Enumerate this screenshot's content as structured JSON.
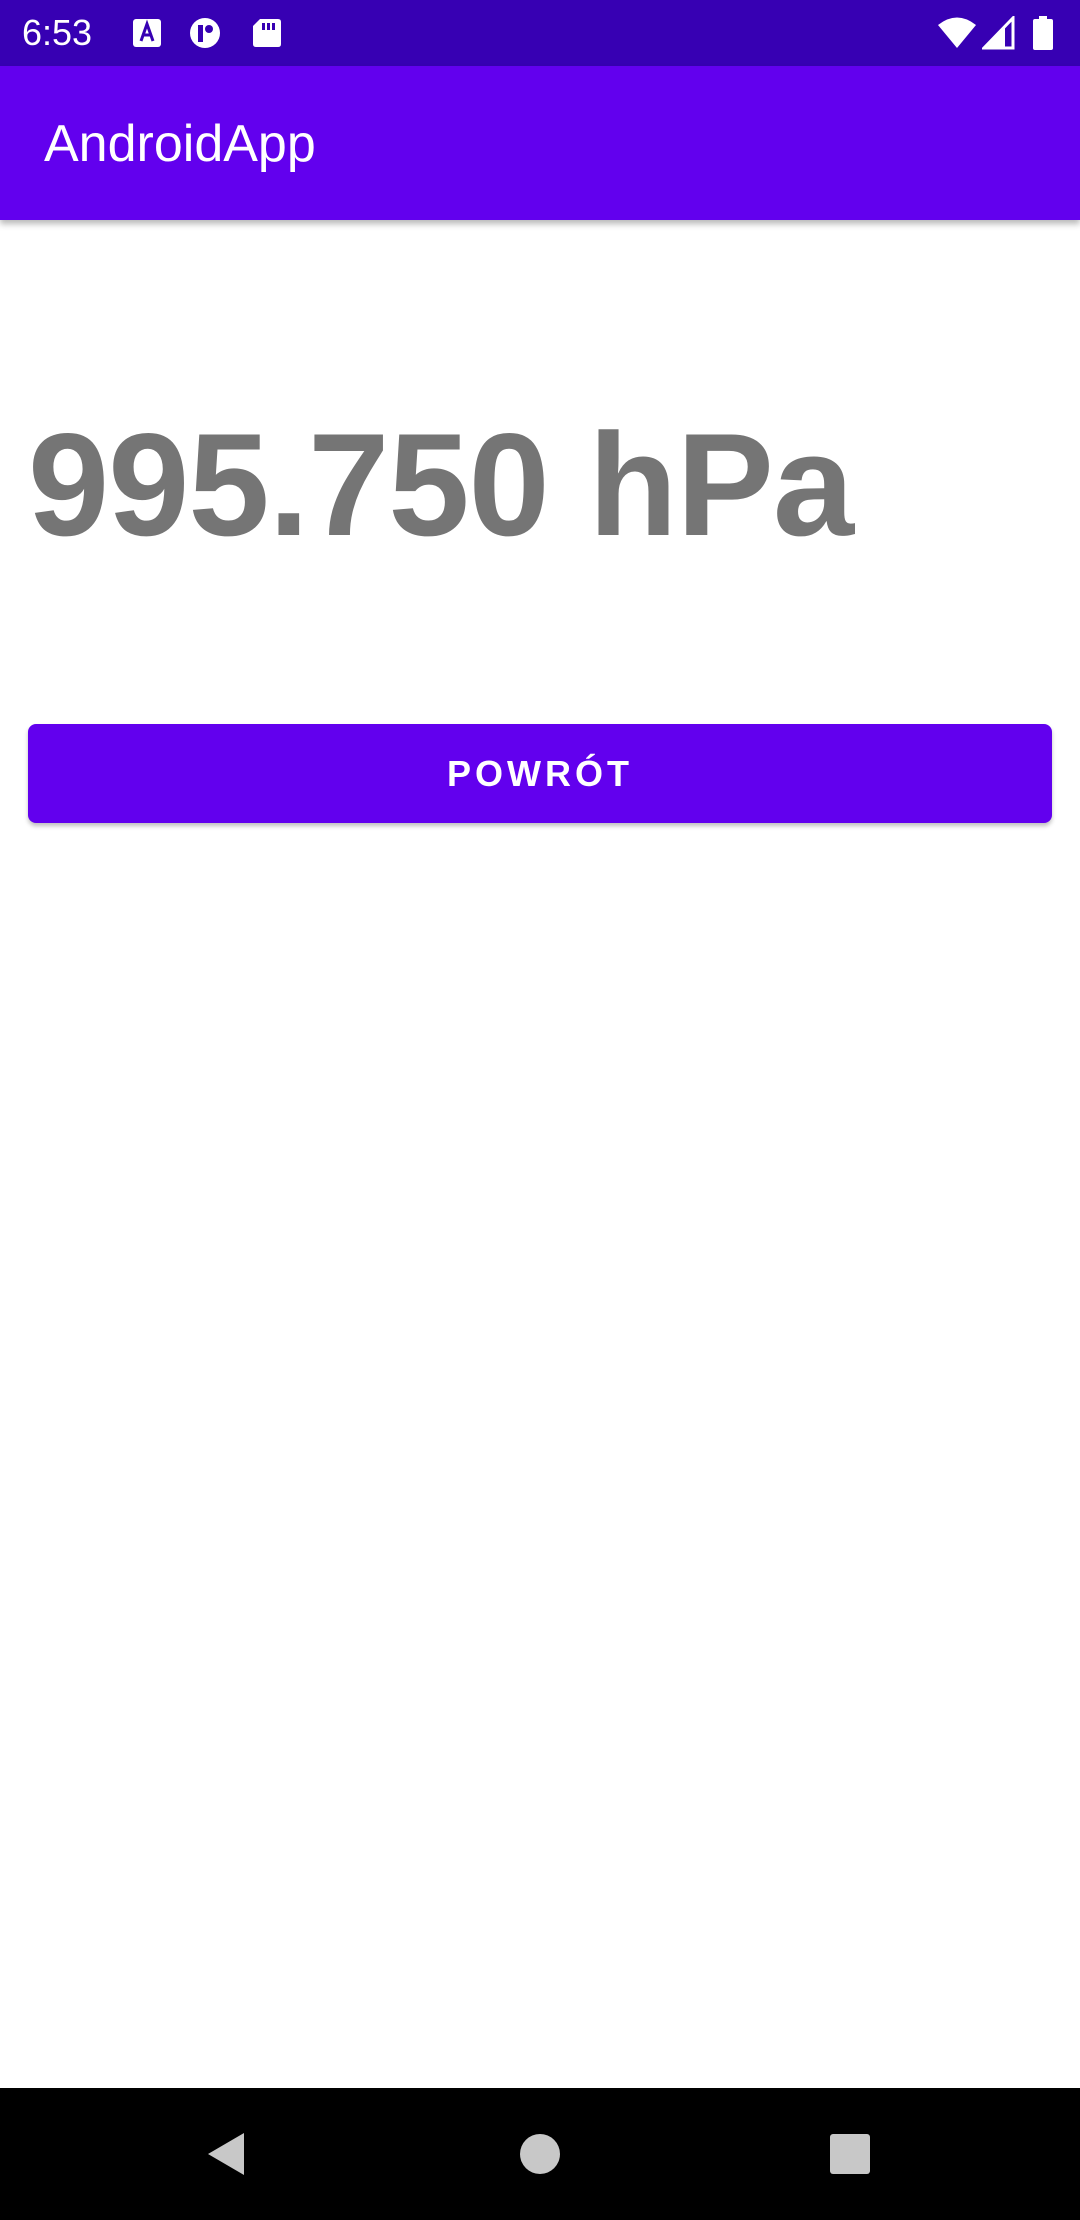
{
  "status_bar": {
    "time": "6:53",
    "left_icons": [
      "text-a-icon",
      "app-badge-icon",
      "sd-card-icon"
    ],
    "right_icons": [
      "wifi-icon",
      "cell-signal-icon",
      "battery-icon"
    ],
    "background_color": "#3700b3"
  },
  "app_bar": {
    "title": "AndroidApp",
    "background_color": "#6200ee"
  },
  "main": {
    "pressure_reading": "995.750 hPa",
    "back_button_label": "POWRÓT",
    "accent_color": "#6200ee",
    "text_color": "#757575"
  },
  "nav_bar": {
    "buttons": [
      "back-icon",
      "home-icon",
      "recents-icon"
    ]
  }
}
